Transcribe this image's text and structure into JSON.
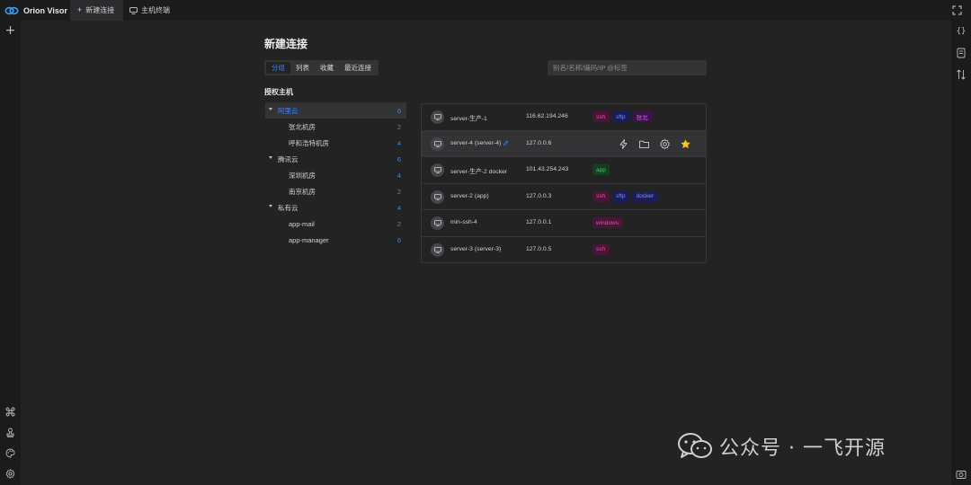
{
  "app": {
    "name": "Orion Visor"
  },
  "tabs": [
    {
      "label": "新建连接",
      "icon": "plus-icon",
      "active": true
    },
    {
      "label": "主机终端",
      "icon": "monitor-icon",
      "active": false
    }
  ],
  "left_rail": {
    "top": [
      {
        "icon": "plus-icon"
      }
    ],
    "bottom": [
      {
        "icon": "command-icon"
      },
      {
        "icon": "stamp-icon"
      },
      {
        "icon": "palette-icon"
      },
      {
        "icon": "gear-icon"
      }
    ]
  },
  "right_rail": {
    "top": [
      {
        "icon": "braces-icon"
      },
      {
        "icon": "snippet-icon"
      },
      {
        "icon": "transfer-icon"
      }
    ],
    "bottom": [
      {
        "icon": "screenshot-icon"
      }
    ]
  },
  "page": {
    "title": "新建连接",
    "view_tabs": [
      {
        "label": "分组",
        "active": true
      },
      {
        "label": "列表",
        "active": false
      },
      {
        "label": "收藏",
        "active": false
      },
      {
        "label": "最近连接",
        "active": false
      }
    ],
    "search": {
      "placeholder": "别名/名称/编码/IP @标签",
      "value": ""
    },
    "section_title": "授权主机"
  },
  "tree": [
    {
      "label": "阿里云",
      "count": "6",
      "level": 0,
      "expanded": true,
      "selected": true
    },
    {
      "label": "张北机房",
      "count": "2",
      "level": 1
    },
    {
      "label": "呼和浩特机房",
      "count": "4",
      "level": 1
    },
    {
      "label": "腾讯云",
      "count": "6",
      "level": 0,
      "expanded": true
    },
    {
      "label": "深圳机房",
      "count": "4",
      "level": 1
    },
    {
      "label": "南京机房",
      "count": "2",
      "level": 1
    },
    {
      "label": "私有云",
      "count": "4",
      "level": 0,
      "expanded": true
    },
    {
      "label": "app-mail",
      "count": "2",
      "level": 1
    },
    {
      "label": "app-manager",
      "count": "6",
      "level": 1
    }
  ],
  "hosts": [
    {
      "name": "server-生产-1",
      "ip": "116.62.194.246",
      "tags": [
        {
          "text": "ssh",
          "kind": "ssh"
        },
        {
          "text": "sftp",
          "kind": "sftp"
        },
        {
          "text": "张北",
          "kind": "north"
        }
      ]
    },
    {
      "name": "server-4 (server-4)",
      "ip": "127.0.0.6",
      "hover": true,
      "editable": true,
      "actions": [
        "lightning-icon",
        "folder-icon",
        "gear-icon",
        "star-icon"
      ]
    },
    {
      "name": "server-生产-2  docker",
      "ip": "101.43.254.243",
      "tags": [
        {
          "text": "app",
          "kind": "app"
        }
      ]
    },
    {
      "name": "server-2 (app)",
      "ip": "127.0.0.3",
      "tags": [
        {
          "text": "ssh",
          "kind": "ssh"
        },
        {
          "text": "sftp",
          "kind": "sftp"
        },
        {
          "text": "docker",
          "kind": "docker"
        }
      ]
    },
    {
      "name": "min-ssh-4",
      "ip": "127.0.0.1",
      "tags": [
        {
          "text": "windows",
          "kind": "windows"
        }
      ]
    },
    {
      "name": "server-3 (server-3)",
      "ip": "127.0.0.5",
      "tags": [
        {
          "text": "ssh",
          "kind": "ssh"
        }
      ]
    }
  ],
  "watermark": {
    "text": "公众号 · 一飞开源"
  },
  "colors": {
    "accent": "#3b82f6",
    "star": "#f5c518",
    "background": "#232324",
    "chrome": "#1b1b1c"
  }
}
